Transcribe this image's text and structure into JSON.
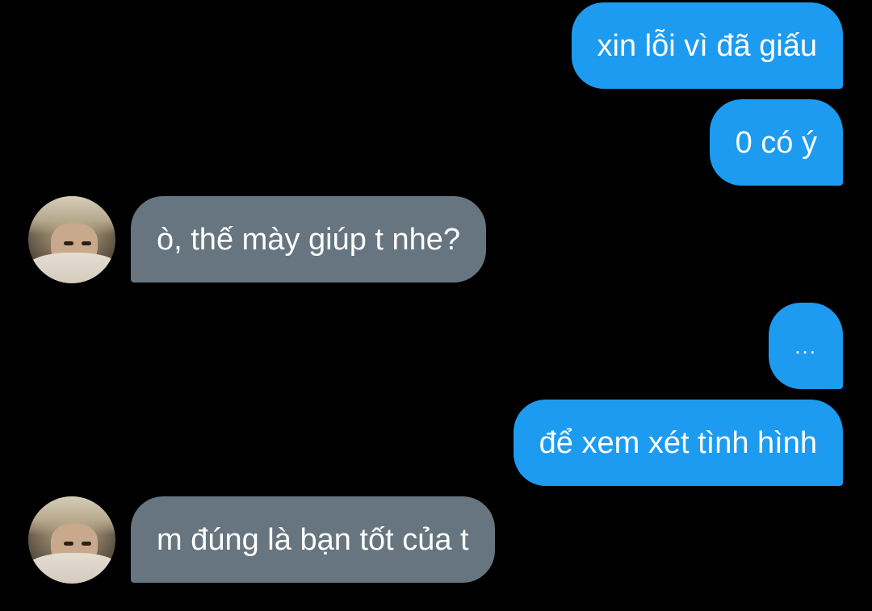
{
  "messages": [
    {
      "direction": "out",
      "text": "xin lỗi vì đã giấu"
    },
    {
      "direction": "out",
      "text": "0 có ý"
    },
    {
      "direction": "in",
      "text": "ò, thế mày giúp t nhe?",
      "avatar_icon": "contact-avatar"
    },
    {
      "direction": "out",
      "text": "..."
    },
    {
      "direction": "out",
      "text": "để xem xét tình hình"
    },
    {
      "direction": "in",
      "text": "m đúng là bạn tốt của t",
      "avatar_icon": "contact-avatar"
    }
  ],
  "colors": {
    "background": "#000000",
    "outgoing_bubble": "#1d9bf0",
    "incoming_bubble": "#66757f",
    "text": "#ffffff"
  }
}
